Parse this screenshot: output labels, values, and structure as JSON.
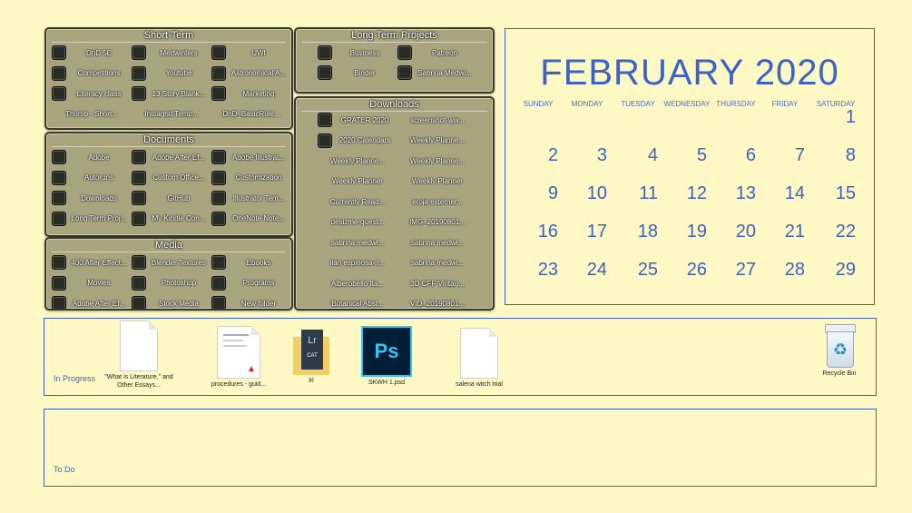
{
  "fences": {
    "short_term": {
      "title": "Short-Term",
      "items": [
        "DnD 5E",
        "Medwinters",
        "UWI",
        "Competitions",
        "Youtube",
        "Astronomical A...",
        "Literacy class",
        "13 Story Blank...",
        "Marketing",
        "Thumb - Short...",
        "Instagrid Temp...",
        "DnD_BasicRule..."
      ]
    },
    "long_term": {
      "title": "Long Term Projects",
      "items": [
        "Business",
        "Patreon",
        "Binder",
        "Sabrina Medwi..."
      ]
    },
    "documents": {
      "title": "Documents",
      "items": [
        "Adobe",
        "Adobe After Ef...",
        "Adobe Illustrat...",
        "Autoruns",
        "Custom Office...",
        "Customization",
        "Downloads",
        "GitHub",
        "Illustrator Tem...",
        "Long Term Proj...",
        "My Kindle Con...",
        "OneNote Note..."
      ]
    },
    "downloads": {
      "title": "Downloads",
      "items": [
        "GRATER 2020",
        "screenshot-ww...",
        "2020 Calendars",
        "Weekly Planne...",
        "Weekly Planne...",
        "Weekly Planne...",
        "Weekly Planner",
        "Weekly Planner",
        "Currently Read...",
        "eroja esterner...",
        "desizme-quest...",
        "IMG_20190801...",
        "sabrina medwi...",
        "sabrina medwi...",
        "ilan espinosa-n...",
        "sabrina medwi...",
        "Alberobello Ita...",
        "3D CFF Vintag...",
        "Botanical Abst...",
        "VID_20190801..."
      ]
    },
    "media": {
      "title": "Media",
      "items": [
        "400 After Effect...",
        "Blender Textures",
        "Ebooks",
        "Movies",
        "Photoshop",
        "Programs",
        "Adobe After Ef...",
        "Stock Media",
        "New folder"
      ]
    }
  },
  "calendar": {
    "title": "FEBRUARY 2020",
    "daynames": [
      "SUNDAY",
      "MONDAY",
      "TUESDAY",
      "WEDNESDAY",
      "THURSDAY",
      "FRIDAY",
      "SATURDAY"
    ],
    "weeks": [
      [
        "",
        "",
        "",
        "",
        "",
        "",
        "1"
      ],
      [
        "2",
        "3",
        "4",
        "5",
        "6",
        "7",
        "8"
      ],
      [
        "9",
        "10",
        "11",
        "12",
        "13",
        "14",
        "15"
      ],
      [
        "16",
        "17",
        "18",
        "19",
        "20",
        "21",
        "22"
      ],
      [
        "23",
        "24",
        "25",
        "26",
        "27",
        "28",
        "29"
      ]
    ]
  },
  "in_progress": {
    "label": "In Progress",
    "files": [
      {
        "label": "\"What is Literature,\" and Other Essays...",
        "icon": "document-icon"
      },
      {
        "label": "procedures - guid...",
        "icon": "pdf-icon"
      },
      {
        "label": "lrl",
        "icon": "lightroom-catalog-icon"
      },
      {
        "label": "SKWH 1.psd",
        "icon": "photoshop-icon"
      },
      {
        "label": "salena witch trial",
        "icon": "document-icon"
      }
    ],
    "recycle_bin": "Recycle Bin"
  },
  "todo": {
    "label": "To Do"
  },
  "colors": {
    "background": "#fdf8c4",
    "accent": "#3b62c4",
    "fence": "#a8a47e"
  }
}
